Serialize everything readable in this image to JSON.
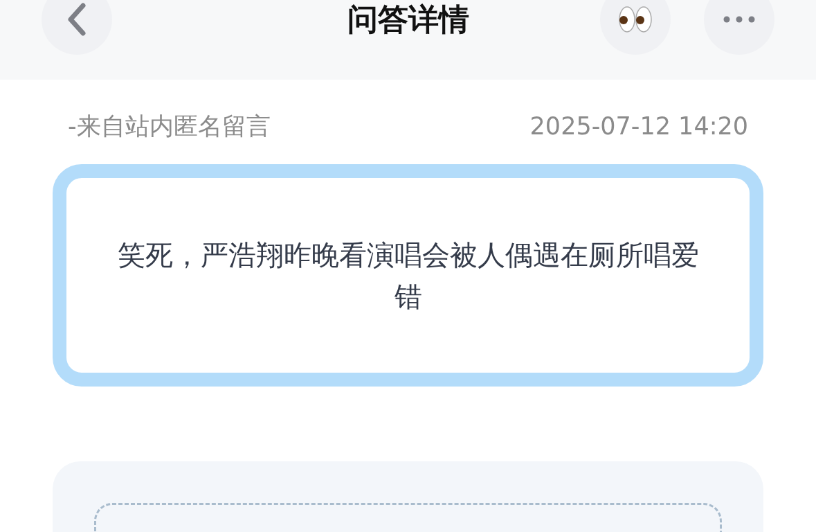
{
  "header": {
    "title": "问答详情"
  },
  "message": {
    "source": "-来自站内匿名留言",
    "time": "2025-07-12 14:20",
    "question": "笑死，严浩翔昨晚看演唱会被人偶遇在厕所唱爱错"
  }
}
